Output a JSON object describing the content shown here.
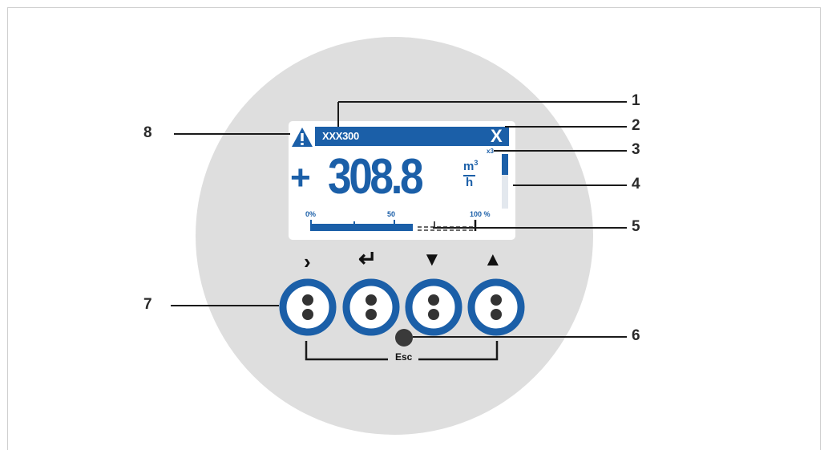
{
  "display": {
    "device_title": "XXX300",
    "close_symbol": "X",
    "sign": "+",
    "measured_value": "308.8",
    "unit_numerator": "m",
    "unit_exponent": "3",
    "unit_denominator": "h",
    "scroll_label": "x3",
    "bargraph": {
      "label_min": "0%",
      "label_mid": "50",
      "label_max": "100 %",
      "fill_fraction": 0.62
    }
  },
  "keys": {
    "right": {
      "symbol": "›"
    },
    "enter": {
      "symbol": "↵"
    },
    "down": {
      "symbol": "▼"
    },
    "up": {
      "symbol": "▲"
    },
    "esc_label": "Esc"
  },
  "callouts": {
    "c1": "1",
    "c2": "2",
    "c3": "3",
    "c4": "4",
    "c5": "5",
    "c6": "6",
    "c7": "7",
    "c8": "8"
  },
  "colors": {
    "accent": "#1b5fa8",
    "housing": "#dedede",
    "line": "#1a1a1a"
  }
}
